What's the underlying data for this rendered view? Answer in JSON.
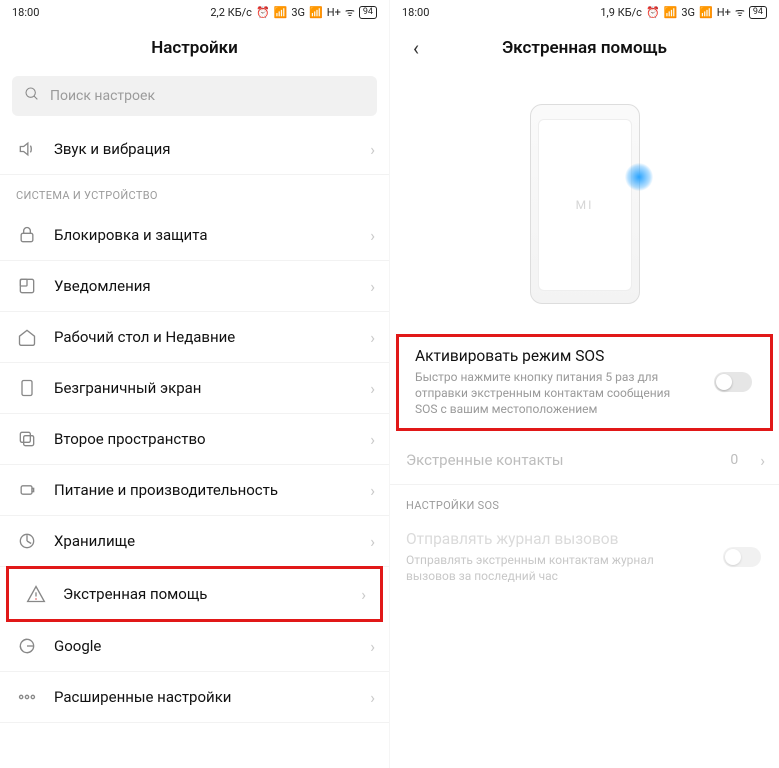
{
  "left": {
    "status": {
      "time": "18:00",
      "net": "2,2 КБ/с",
      "sig": "3G",
      "sig2": "H+",
      "battery": "94"
    },
    "title": "Настройки",
    "search_placeholder": "Поиск настроек",
    "first_item": {
      "label": "Звук и вибрация"
    },
    "section1": "СИСТЕМА И УСТРОЙСТВО",
    "items": [
      {
        "label": "Блокировка и защита"
      },
      {
        "label": "Уведомления"
      },
      {
        "label": "Рабочий стол и Недавние"
      },
      {
        "label": "Безграничный экран"
      },
      {
        "label": "Второе пространство"
      },
      {
        "label": "Питание и производительность"
      },
      {
        "label": "Хранилище"
      },
      {
        "label": "Экстренная помощь"
      },
      {
        "label": "Google"
      },
      {
        "label": "Расширенные настройки"
      }
    ]
  },
  "right": {
    "status": {
      "time": "18:00",
      "net": "1,9 КБ/с",
      "sig": "3G",
      "sig2": "H+",
      "battery": "94"
    },
    "title": "Экстренная помощь",
    "phone_logo": "MI",
    "sos": {
      "title": "Активировать режим SOS",
      "sub": "Быстро нажмите кнопку питания 5 раз для отправки экстренным контактам сообщения SOS с вашим местоположением"
    },
    "contacts": {
      "label": "Экстренные контакты",
      "value": "0"
    },
    "section": "НАСТРОЙКИ SOS",
    "call_log": {
      "title": "Отправлять журнал вызовов",
      "sub": "Отправлять экстренным контактам журнал вызовов за последний час"
    }
  }
}
